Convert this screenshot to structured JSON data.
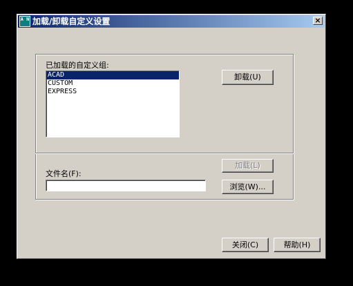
{
  "window": {
    "title": "加载/卸载自定义设置",
    "icon_text": "A N",
    "close_label": "×"
  },
  "groups": {
    "loaded_label": "已加载的自定义组:",
    "items": [
      "ACAD",
      "CUSTOM",
      "EXPRESS"
    ],
    "selected_index": 0
  },
  "buttons": {
    "unload": "卸载(U)",
    "load": "加载(L)",
    "browse": "浏览(W)...",
    "close": "关闭(C)",
    "help": "帮助(H)"
  },
  "file": {
    "label": "文件名(F):",
    "value": ""
  }
}
